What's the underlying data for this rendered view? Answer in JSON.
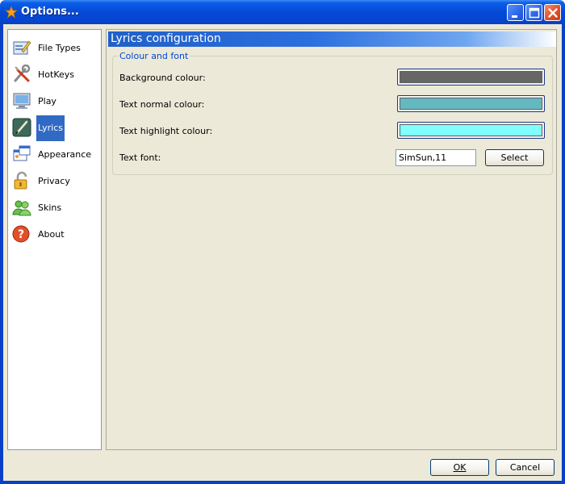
{
  "window": {
    "title": "Options...",
    "minimize_icon": "minimize-icon",
    "maximize_icon": "maximize-icon",
    "close_icon": "close-icon"
  },
  "sidebar": {
    "items": [
      {
        "label": "File Types",
        "icon": "file-types-icon"
      },
      {
        "label": "HotKeys",
        "icon": "hotkeys-icon"
      },
      {
        "label": "Play",
        "icon": "play-icon"
      },
      {
        "label": "Lyrics",
        "icon": "lyrics-icon",
        "selected": true
      },
      {
        "label": "Appearance",
        "icon": "appearance-icon"
      },
      {
        "label": "Privacy",
        "icon": "privacy-lock-icon"
      },
      {
        "label": "Skins",
        "icon": "skins-icon"
      },
      {
        "label": "About",
        "icon": "about-help-icon"
      }
    ]
  },
  "panel": {
    "header": "Lyrics configuration",
    "group_title": "Colour and font",
    "background_colour_label": "Background colour:",
    "text_normal_colour_label": "Text normal colour:",
    "text_highlight_colour_label": "Text highlight colour:",
    "text_font_label": "Text font:",
    "text_font_value": "SimSun,11",
    "select_label": "Select"
  },
  "colors": {
    "background": "#666666",
    "text_normal": "#66b8c0",
    "text_highlight": "#80ffff"
  },
  "footer": {
    "ok_label": "OK",
    "cancel_label": "Cancel"
  }
}
